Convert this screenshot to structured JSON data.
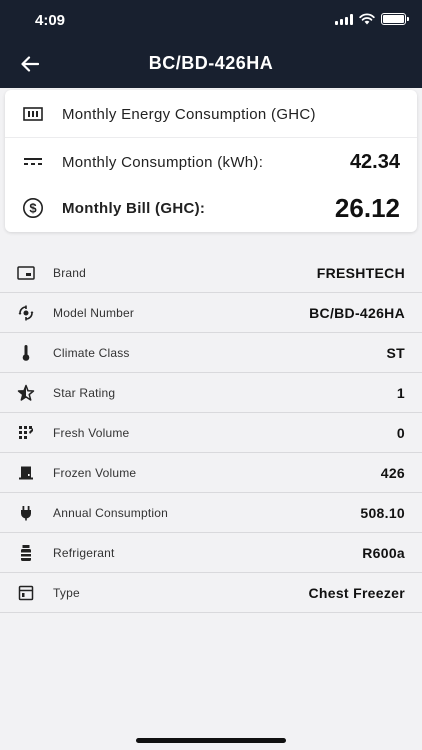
{
  "status_bar": {
    "time": "4:09"
  },
  "header": {
    "title": "BC/BD-426HA",
    "back_icon": "arrow-left-icon"
  },
  "energy_card": {
    "heading": "Monthly Energy Consumption (GHC)",
    "consumption_label": "Monthly Consumption (kWh):",
    "consumption_value": "42.34",
    "bill_label": "Monthly Bill (GHC):",
    "bill_value": "26.12"
  },
  "details": [
    {
      "icon": "brand-icon",
      "label": "Brand",
      "value": "FRESHTECH"
    },
    {
      "icon": "model-icon",
      "label": "Model Number",
      "value": "BC/BD-426HA"
    },
    {
      "icon": "thermometer-icon",
      "label": "Climate Class",
      "value": "ST"
    },
    {
      "icon": "star-icon",
      "label": "Star Rating",
      "value": "1"
    },
    {
      "icon": "grid-icon",
      "label": "Fresh Volume",
      "value": "0"
    },
    {
      "icon": "box-icon",
      "label": "Frozen Volume",
      "value": "426"
    },
    {
      "icon": "plug-icon",
      "label": "Annual Consumption",
      "value": "508.10"
    },
    {
      "icon": "canister-icon",
      "label": "Refrigerant",
      "value": "R600a"
    },
    {
      "icon": "type-icon",
      "label": "Type",
      "value": "Chest Freezer"
    }
  ],
  "colors": {
    "header_bg": "#18202f",
    "page_bg": "#f2f2f4",
    "card_bg": "#ffffff"
  }
}
